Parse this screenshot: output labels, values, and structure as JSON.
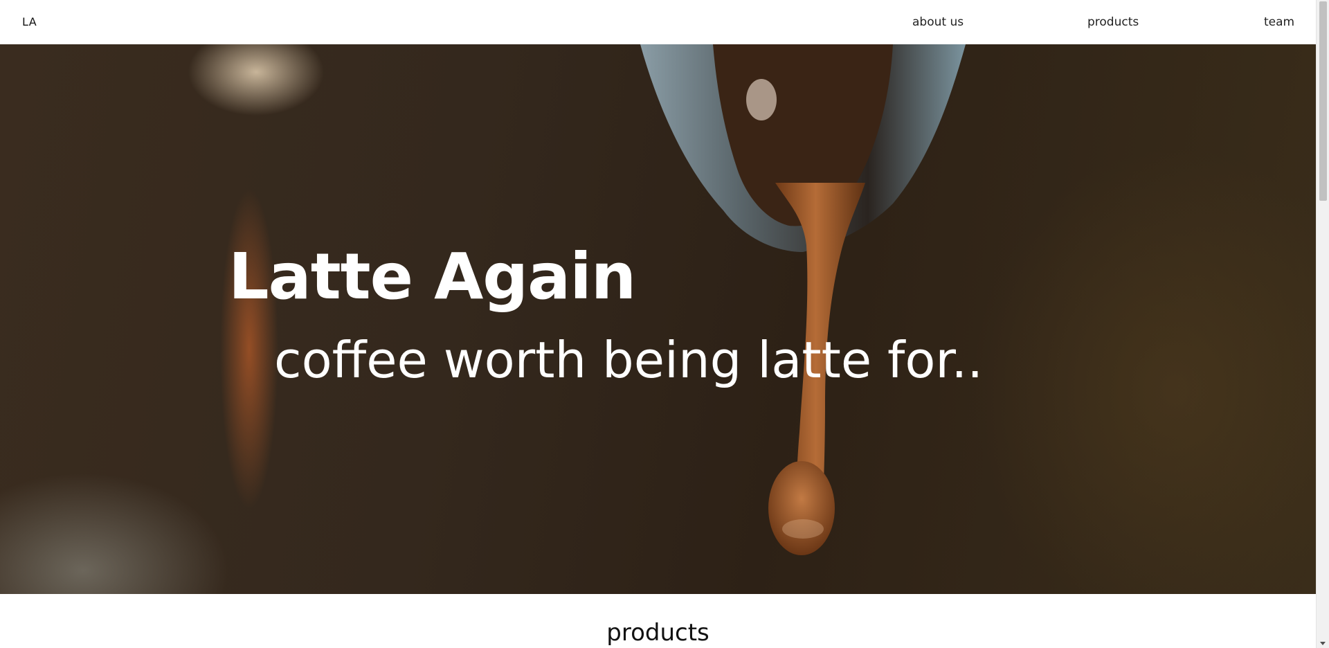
{
  "nav": {
    "logo": "LA",
    "links": [
      {
        "label": "about us"
      },
      {
        "label": "products"
      },
      {
        "label": "team"
      }
    ]
  },
  "hero": {
    "title": "Latte Again",
    "subtitle": "coffee worth being latte for.."
  },
  "sections": {
    "products_title": "products"
  },
  "colors": {
    "hero_bg": "#33271c",
    "coffee_stream": "#a7602f",
    "text_light": "#ffffff",
    "text_dark": "#111111"
  }
}
